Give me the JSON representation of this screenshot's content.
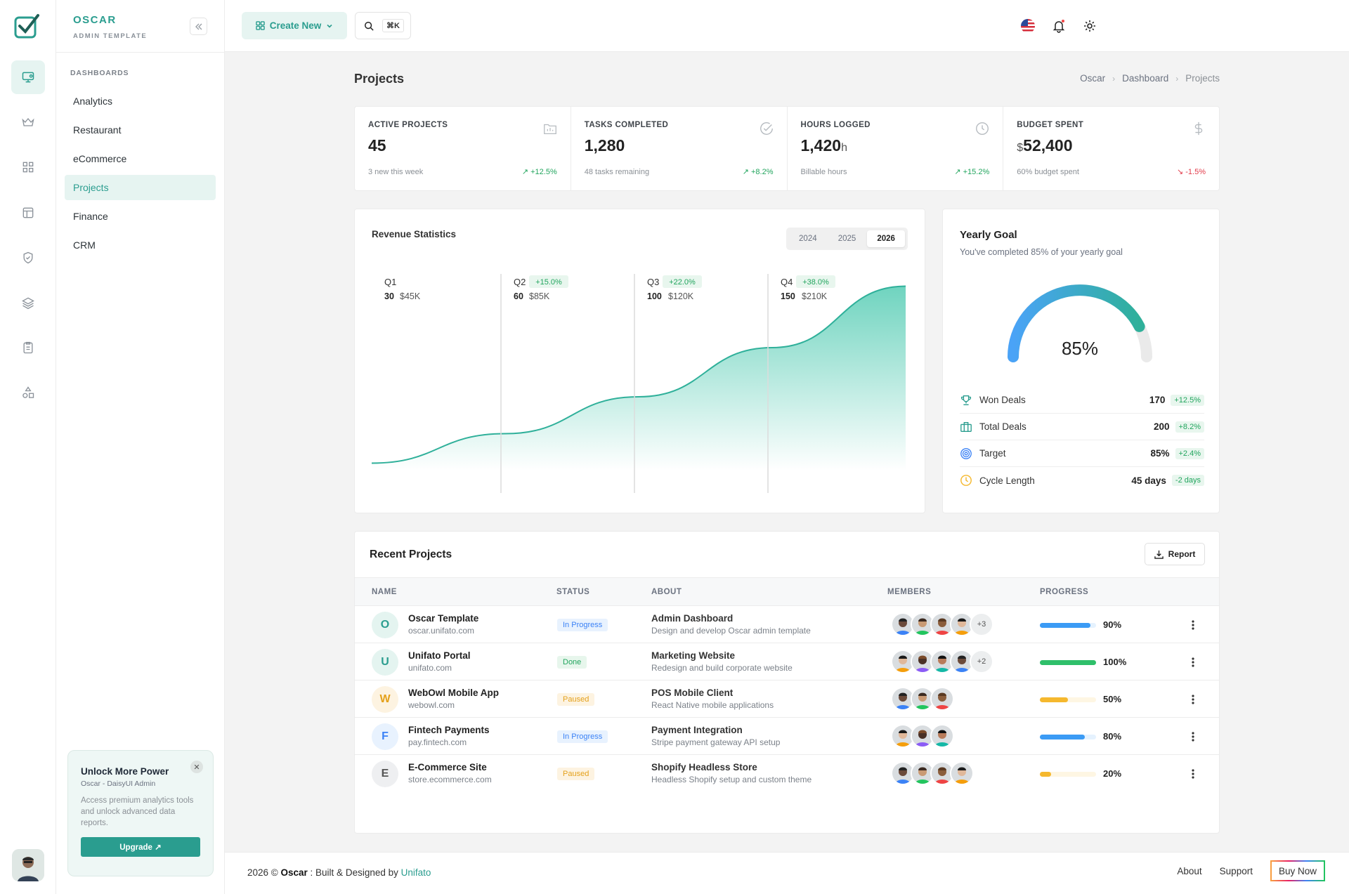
{
  "brand": {
    "name": "OSCAR",
    "tagline": "ADMIN TEMPLATE"
  },
  "rail": {
    "icons": [
      "monitor-icon",
      "crown-icon",
      "grid-icon",
      "layout-icon",
      "shield-check-icon",
      "layers-icon",
      "clipboard-icon",
      "shapes-icon"
    ],
    "active": 0
  },
  "sidebar": {
    "section": "DASHBOARDS",
    "items": [
      {
        "label": "Analytics"
      },
      {
        "label": "Restaurant"
      },
      {
        "label": "eCommerce"
      },
      {
        "label": "Projects",
        "active": true
      },
      {
        "label": "Finance"
      },
      {
        "label": "CRM"
      }
    ]
  },
  "promo": {
    "title": "Unlock More Power",
    "subtitle": "Oscar - DaisyUI Admin",
    "desc": "Access premium analytics tools and unlock advanced data reports.",
    "button": "Upgrade ↗",
    "close": "✕"
  },
  "topbar": {
    "create_label": "Create New",
    "search_shortcut": "⌘K"
  },
  "page": {
    "title": "Projects",
    "breadcrumb": [
      "Oscar",
      "Dashboard",
      "Projects"
    ]
  },
  "stats": [
    {
      "label": "ACTIVE PROJECTS",
      "value": "45",
      "unit_prefix": "",
      "unit_suffix": "",
      "sub": "3 new this week",
      "change": "+12.5%",
      "positive": true
    },
    {
      "label": "TASKS COMPLETED",
      "value": "1,280",
      "unit_prefix": "",
      "unit_suffix": "",
      "sub": "48 tasks remaining",
      "change": "+8.2%",
      "positive": true
    },
    {
      "label": "HOURS LOGGED",
      "value": "1,420",
      "unit_prefix": "",
      "unit_suffix": "h",
      "sub": "Billable hours",
      "change": "+15.2%",
      "positive": true
    },
    {
      "label": "BUDGET SPENT",
      "value": "52,400",
      "unit_prefix": "$",
      "unit_suffix": "",
      "sub": "60% budget spent",
      "change": "-1.5%",
      "positive": false
    }
  ],
  "revenue": {
    "title": "Revenue Statistics",
    "years": [
      "2024",
      "2025",
      "2026"
    ],
    "selected_year": "2026"
  },
  "chart_data": {
    "type": "area",
    "categories": [
      "Q1",
      "Q2",
      "Q3",
      "Q4"
    ],
    "series": [
      {
        "values": [
          30,
          60,
          100,
          150
        ]
      }
    ],
    "revenue_labels": [
      "$45K",
      "$85K",
      "$120K",
      "$210K"
    ],
    "changes": [
      "",
      "+15.0%",
      "+22.0%",
      "+38.0%"
    ],
    "color": "#2fb09a"
  },
  "goal": {
    "title": "Yearly Goal",
    "subtitle": "You've completed 85% of your yearly goal",
    "percent": 85,
    "percent_label": "85%",
    "items": [
      {
        "icon": "trophy-icon",
        "label": "Won Deals",
        "value": "170",
        "change": "+12.5%"
      },
      {
        "icon": "briefcase-icon",
        "label": "Total Deals",
        "value": "200",
        "change": "+8.2%"
      },
      {
        "icon": "target-icon",
        "label": "Target",
        "value": "85%",
        "change": "+2.4%"
      },
      {
        "icon": "clock-icon",
        "label": "Cycle Length",
        "value": "45 days",
        "change": "-2 days"
      }
    ]
  },
  "projects": {
    "title": "Recent Projects",
    "report_label": "Report",
    "columns": [
      "NAME",
      "STATUS",
      "ABOUT",
      "MEMBERS",
      "PROGRESS"
    ],
    "rows": [
      {
        "initial": "O",
        "name": "Oscar Template",
        "domain": "oscar.unifato.com",
        "status": "In Progress",
        "about_title": "Admin Dashboard",
        "about_desc": "Design and develop Oscar admin template",
        "members": 4,
        "more": "+3",
        "progress": 90,
        "progress_label": "90%",
        "color": "#3b9bf5"
      },
      {
        "initial": "U",
        "name": "Unifato Portal",
        "domain": "unifato.com",
        "status": "Done",
        "about_title": "Marketing Website",
        "about_desc": "Redesign and build corporate website",
        "members": 4,
        "more": "+2",
        "progress": 100,
        "progress_label": "100%",
        "color": "#2fbf6a"
      },
      {
        "initial": "W",
        "name": "WebOwl Mobile App",
        "domain": "webowl.com",
        "status": "Paused",
        "about_title": "POS Mobile Client",
        "about_desc": "React Native mobile applications",
        "members": 3,
        "more": "",
        "progress": 50,
        "progress_label": "50%",
        "color": "#f5b82e"
      },
      {
        "initial": "F",
        "name": "Fintech Payments",
        "domain": "pay.fintech.com",
        "status": "In Progress",
        "about_title": "Payment Integration",
        "about_desc": "Stripe payment gateway API setup",
        "members": 3,
        "more": "",
        "progress": 80,
        "progress_label": "80%",
        "color": "#3b9bf5"
      },
      {
        "initial": "E",
        "name": "E-Commerce Site",
        "domain": "store.ecommerce.com",
        "status": "Paused",
        "about_title": "Shopify Headless Store",
        "about_desc": "Headless Shopify setup and custom theme",
        "members": 4,
        "more": "",
        "progress": 20,
        "progress_label": "20%",
        "color": "#f5b82e"
      }
    ]
  },
  "footer": {
    "year": "2026 ©",
    "brand": "Oscar",
    "mid": ": Built & Designed by",
    "author": "Unifato",
    "links": [
      "About",
      "Support"
    ],
    "buy": "Buy Now"
  }
}
